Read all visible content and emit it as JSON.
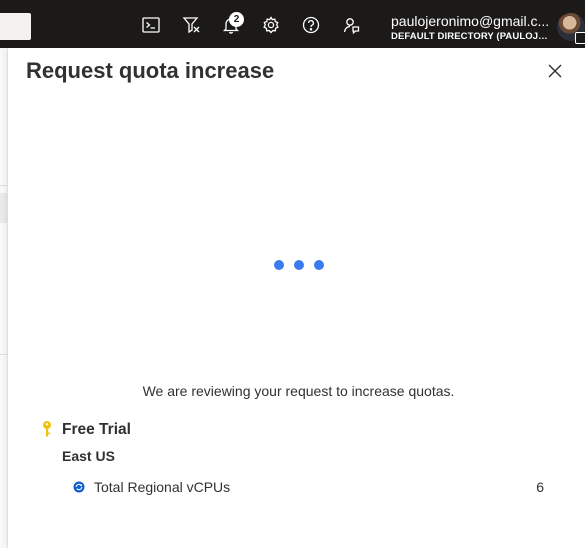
{
  "topbar": {
    "notifications_count": "2",
    "account_email": "paulojeronimo@gmail.c...",
    "account_directory": "DEFAULT DIRECTORY (PAULOJER..."
  },
  "panel": {
    "title": "Request quota increase",
    "status_message": "We are reviewing your request to increase quotas.",
    "subscription_name": "Free Trial",
    "region": "East US",
    "quota_items": [
      {
        "label": "Total Regional vCPUs",
        "value": "6"
      }
    ]
  },
  "icons": {
    "cloud_shell": "terminal-icon",
    "directory_filter": "filter-icon",
    "notifications": "bell-icon",
    "settings": "gear-icon",
    "help": "help-icon",
    "feedback": "feedback-icon",
    "close": "close-icon",
    "subscription": "key-icon",
    "quota_status": "refresh-icon"
  },
  "colors": {
    "topbar": "#1b1a19",
    "spinner": "#3a7bf0",
    "key": "#f2c10f",
    "status_icon": "#0f5ccf"
  }
}
